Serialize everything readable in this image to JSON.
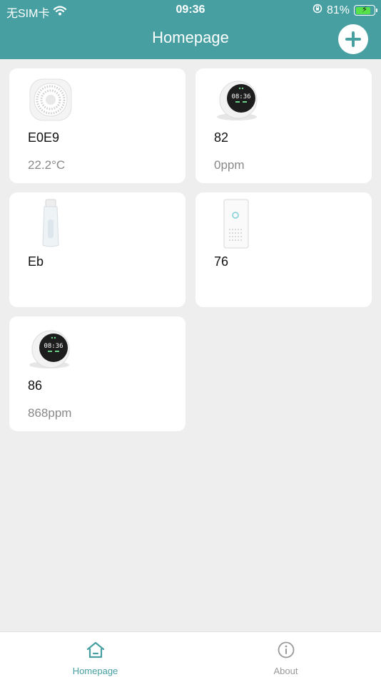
{
  "status_bar": {
    "carrier": "无SIM卡",
    "time": "09:36",
    "battery_percent": "81%",
    "battery_level": 0.81
  },
  "header": {
    "title": "Homepage",
    "add_icon": "plus-icon"
  },
  "devices": [
    {
      "name": "E0E9",
      "value": "22.2°C",
      "icon": "round-speaker-sensor"
    },
    {
      "name": "82",
      "value": "0ppm",
      "icon": "round-clock-monitor"
    },
    {
      "name": "Eb",
      "value": "",
      "icon": "bottle-device"
    },
    {
      "name": "76",
      "value": "",
      "icon": "rectangular-sensor"
    },
    {
      "name": "86",
      "value": "868ppm",
      "icon": "round-clock-monitor"
    }
  ],
  "tabbar": {
    "tabs": [
      {
        "label": "Homepage",
        "icon": "home-icon",
        "active": true
      },
      {
        "label": "About",
        "icon": "info-icon",
        "active": false
      }
    ]
  },
  "colors": {
    "accent": "#479fa2",
    "background": "#eeeeee",
    "card": "#ffffff"
  }
}
